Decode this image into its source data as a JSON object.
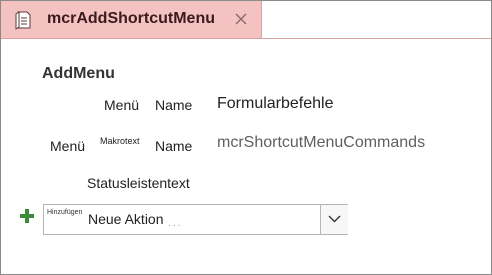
{
  "tab": {
    "title": "mcrAddShortcutMenu",
    "icon": "macro-document-icon",
    "close_icon": "close-icon"
  },
  "action": {
    "heading": "AddMenu",
    "row1": {
      "prefix_label": "Menü",
      "name_label": "Name",
      "value": "Formularbefehle"
    },
    "row2": {
      "prefix_label": "Menü",
      "small_label": "Makrotext",
      "name_label": "Name",
      "value": "mcrShortcutMenuCommands"
    },
    "row3": {
      "label": "Statusleistentext"
    }
  },
  "new_action": {
    "add_icon": "plus-icon",
    "hint": "Hinzufügen",
    "value": "Neue Aktion",
    "dropdown_icon": "chevron-down-icon"
  },
  "colors": {
    "tab_background": "#f5c2c2",
    "plus_green": "#3c8a3c"
  }
}
